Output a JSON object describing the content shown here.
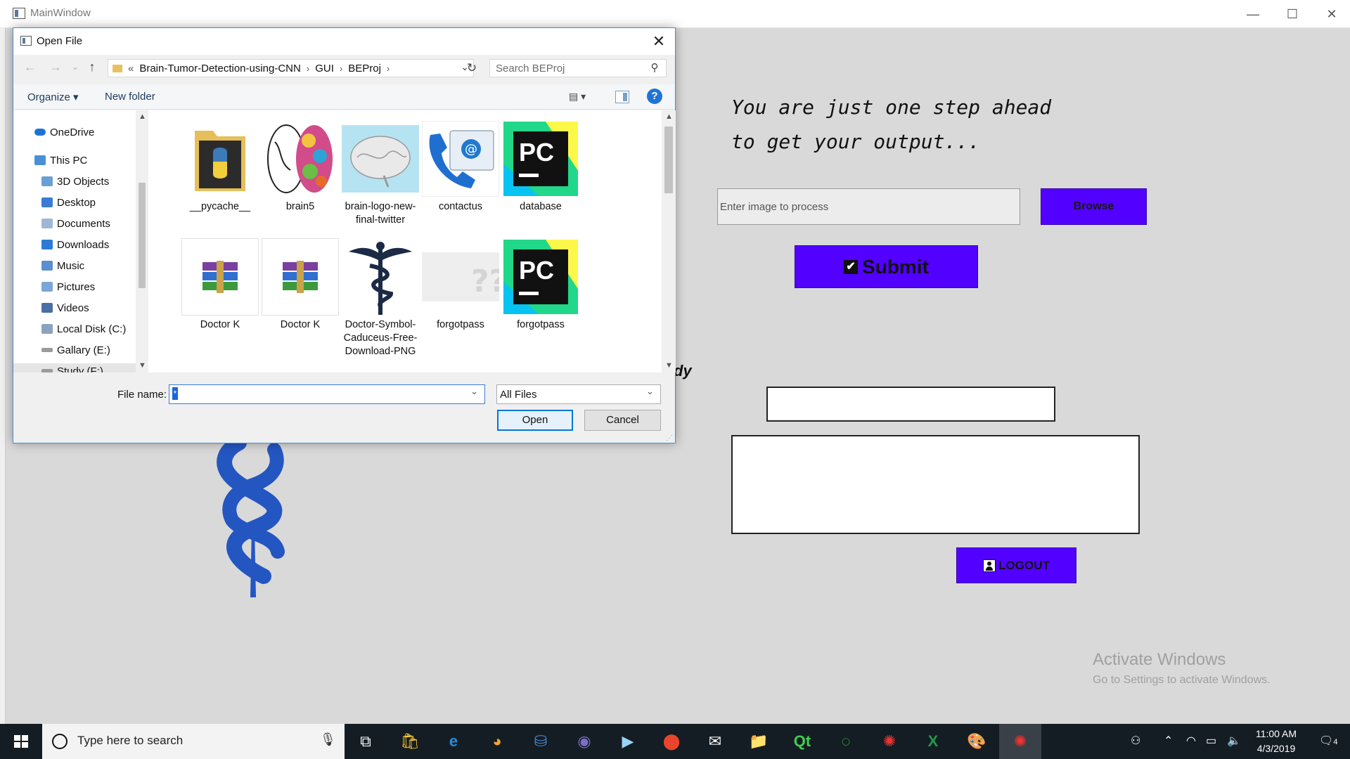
{
  "main_window": {
    "title": "MainWindow",
    "controls": {
      "minimize": "—",
      "maximize": "☐",
      "close": "✕"
    },
    "hero_lines": [
      "You are just one step ahead",
      "to get your output..."
    ],
    "image_input_placeholder": "Enter image to process",
    "browse_label": "Browse",
    "submit_label": "Submit",
    "result_label_fragment": "dy",
    "logout_label": "LOGOUT"
  },
  "watermark": {
    "line1": "Activate Windows",
    "line2": "Go to Settings to activate Windows."
  },
  "dialog": {
    "title": "Open File",
    "close_glyph": "✕",
    "breadcrumb": [
      "«",
      "Brain-Tumor-Detection-using-CNN",
      "GUI",
      "BEProj"
    ],
    "search_placeholder": "Search BEProj",
    "toolbar": {
      "organize": "Organize ▾",
      "new_folder": "New folder",
      "help": "?"
    },
    "nav_items": [
      "OneDrive",
      "This PC",
      "3D Objects",
      "Desktop",
      "Documents",
      "Downloads",
      "Music",
      "Pictures",
      "Videos",
      "Local Disk (C:)",
      "Gallary (E:)",
      "Study (F:)"
    ],
    "files": [
      {
        "name": "__pycache__",
        "icon": "folder-python-icon"
      },
      {
        "name": "brain5",
        "icon": "brain-image-icon"
      },
      {
        "name": "brain-logo-new-final-twitter",
        "icon": "brain-sketch-icon"
      },
      {
        "name": "contactus",
        "icon": "phone-mail-icon"
      },
      {
        "name": "database",
        "icon": "pycharm-icon"
      },
      {
        "name": "Doctor K",
        "icon": "winrar-icon"
      },
      {
        "name": "Doctor K",
        "icon": "winrar-icon"
      },
      {
        "name": "Doctor-Symbol-Caduceus-Free-Download-PNG",
        "icon": "caduceus-icon"
      },
      {
        "name": "forgotpass",
        "icon": "question-image-icon"
      },
      {
        "name": "forgotpass",
        "icon": "pycharm-icon"
      }
    ],
    "file_name_label": "File name:",
    "file_name_value": "*",
    "file_type": "All Files",
    "open_label": "Open",
    "cancel_label": "Cancel"
  },
  "taskbar": {
    "search_placeholder": "Type here to search",
    "time": "11:00 AM",
    "date": "4/3/2019",
    "notification_count": "4"
  },
  "colors": {
    "accent_purple": "#5200ff",
    "dialog_border": "#4d8ad6",
    "taskbar": "#151d24"
  }
}
